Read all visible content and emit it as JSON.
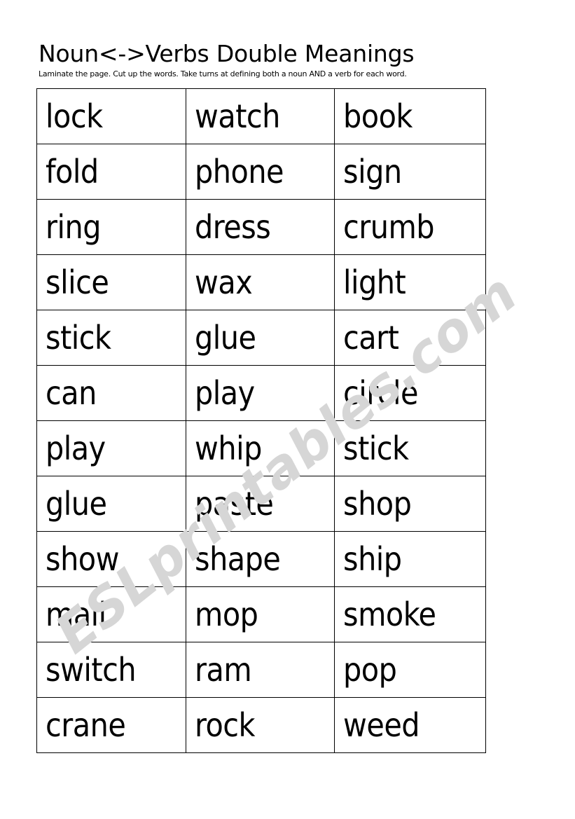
{
  "document": {
    "title": "Noun<->Verbs Double Meanings",
    "subtitle": "Laminate the page.  Cut up the words.  Take turns at defining both a noun AND a verb for each word.",
    "watermark": "ESLprintables.com",
    "watermark_color": "#d6d6d6",
    "text_color": "#000000",
    "background_color": "#ffffff",
    "border_color": "#000000"
  },
  "word_table": {
    "columns": 3,
    "rows": 12,
    "cells": [
      [
        "lock",
        "watch",
        "book"
      ],
      [
        "fold",
        "phone",
        "sign"
      ],
      [
        "ring",
        "dress",
        "crumb"
      ],
      [
        "slice",
        "wax",
        "light"
      ],
      [
        "stick",
        "glue",
        "cart"
      ],
      [
        "can",
        "play",
        "circle"
      ],
      [
        "play",
        "whip",
        "stick"
      ],
      [
        "glue",
        "paste",
        "shop"
      ],
      [
        "show",
        "shape",
        "ship"
      ],
      [
        "mail",
        "mop",
        "smoke"
      ],
      [
        "switch",
        "ram",
        "pop"
      ],
      [
        "crane",
        "rock",
        "weed"
      ]
    ]
  }
}
